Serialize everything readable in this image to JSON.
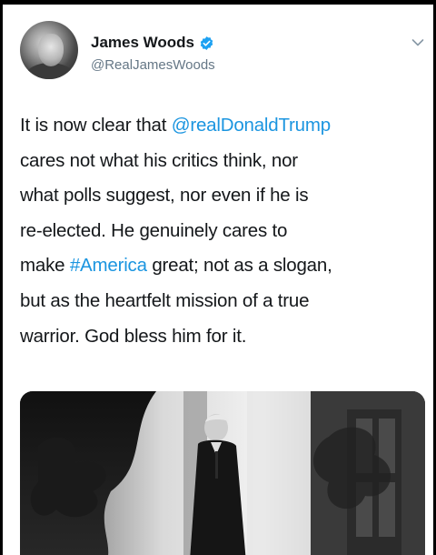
{
  "tweet": {
    "author": {
      "display_name": "James Woods",
      "handle": "@RealJamesWoods",
      "verified": true,
      "avatar_icon": "avatar-photo"
    },
    "menu_icon": "chevron-down-icon",
    "text": {
      "line1_pre": "It is now clear that ",
      "line1_mention": "@realDonaldTrump",
      "line2": "cares not what his critics think, nor",
      "line3": "what polls suggest, nor even if he is",
      "line4": "re-elected. He genuinely cares to",
      "line5_pre": "make ",
      "line5_hashtag": "#America",
      "line5_post": " great; not as a slogan,",
      "line6": "but as the heartfelt mission of a true",
      "line7": "warrior. God bless him for it."
    },
    "media": {
      "type": "photo"
    }
  },
  "colors": {
    "link": "#1b95e0",
    "verified": "#1da1f2",
    "text": "#14171a",
    "secondary": "#657786"
  }
}
